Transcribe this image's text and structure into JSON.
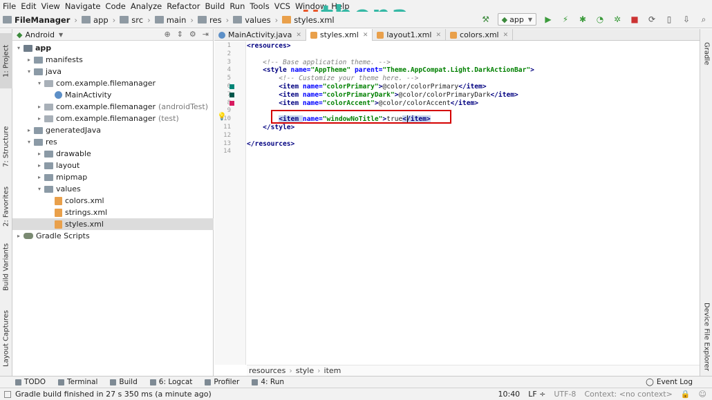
{
  "menu": [
    "File",
    "Edit",
    "View",
    "Navigate",
    "Code",
    "Analyze",
    "Refactor",
    "Build",
    "Run",
    "Tools",
    "VCS",
    "Window",
    "Help"
  ],
  "watermark": {
    "text_u": "u",
    "text_rest": "thena",
    "color_u": "#e8572a",
    "color_rest": "#35b8a5"
  },
  "breadcrumbs": [
    "FileManager",
    "app",
    "src",
    "main",
    "res",
    "values",
    "styles.xml"
  ],
  "run_config": "app",
  "left_tools": [
    "1: Project",
    "7: Structure",
    "2: Favorites",
    "Build Variants",
    "Layout Captures"
  ],
  "right_tools": [
    "Gradle",
    "Device File Explorer"
  ],
  "project": {
    "view": "Android",
    "tree": [
      {
        "label": "app",
        "depth": 0,
        "arrow": "▾",
        "icon": "mod",
        "bold": true
      },
      {
        "label": "manifests",
        "depth": 1,
        "arrow": "▸",
        "icon": "dir"
      },
      {
        "label": "java",
        "depth": 1,
        "arrow": "▾",
        "icon": "dir"
      },
      {
        "label": "com.example.filemanager",
        "depth": 2,
        "arrow": "▾",
        "icon": "pkg"
      },
      {
        "label": "MainActivity",
        "depth": 3,
        "arrow": "",
        "icon": "cls"
      },
      {
        "label": "com.example.filemanager",
        "depth": 2,
        "arrow": "▸",
        "icon": "pkg",
        "suffix": "(androidTest)"
      },
      {
        "label": "com.example.filemanager",
        "depth": 2,
        "arrow": "▸",
        "icon": "pkg",
        "suffix": "(test)"
      },
      {
        "label": "generatedJava",
        "depth": 1,
        "arrow": "▸",
        "icon": "dir"
      },
      {
        "label": "res",
        "depth": 1,
        "arrow": "▾",
        "icon": "dir"
      },
      {
        "label": "drawable",
        "depth": 2,
        "arrow": "▸",
        "icon": "dir"
      },
      {
        "label": "layout",
        "depth": 2,
        "arrow": "▸",
        "icon": "dir"
      },
      {
        "label": "mipmap",
        "depth": 2,
        "arrow": "▸",
        "icon": "dir"
      },
      {
        "label": "values",
        "depth": 2,
        "arrow": "▾",
        "icon": "dir"
      },
      {
        "label": "colors.xml",
        "depth": 3,
        "arrow": "",
        "icon": "xml"
      },
      {
        "label": "strings.xml",
        "depth": 3,
        "arrow": "",
        "icon": "xml"
      },
      {
        "label": "styles.xml",
        "depth": 3,
        "arrow": "",
        "icon": "xml",
        "selected": true
      },
      {
        "label": "Gradle Scripts",
        "depth": 0,
        "arrow": "▸",
        "icon": "grd"
      }
    ]
  },
  "tabs": [
    {
      "label": "MainActivity.java",
      "type": "java"
    },
    {
      "label": "styles.xml",
      "type": "xml",
      "active": true
    },
    {
      "label": "layout1.xml",
      "type": "xml"
    },
    {
      "label": "colors.xml",
      "type": "xml"
    }
  ],
  "line_numbers": [
    "1",
    "2",
    "3",
    "4",
    "5",
    "6",
    "7",
    "8",
    "9",
    "10",
    "11",
    "12",
    "13",
    "14"
  ],
  "gutter_marks": [
    {
      "line": 6,
      "color": "#008577"
    },
    {
      "line": 7,
      "color": "#00574B"
    },
    {
      "line": 8,
      "color": "#D81B60"
    }
  ],
  "code": [
    [
      {
        "t": "<",
        "c": "tg"
      },
      {
        "t": "resources",
        "c": "tg"
      },
      {
        "t": ">",
        "c": "tg"
      }
    ],
    [],
    [
      {
        "t": "    "
      },
      {
        "t": "<!-- Base application theme. -->",
        "c": "cm"
      }
    ],
    [
      {
        "t": "    "
      },
      {
        "t": "<style ",
        "c": "tg"
      },
      {
        "t": "name=",
        "c": "at"
      },
      {
        "t": "\"AppTheme\"",
        "c": "av"
      },
      {
        "t": " "
      },
      {
        "t": "parent=",
        "c": "at"
      },
      {
        "t": "\"Theme.AppCompat.Light.DarkActionBar\"",
        "c": "av"
      },
      {
        "t": ">",
        "c": "tg"
      }
    ],
    [
      {
        "t": "        "
      },
      {
        "t": "<!-- Customize your theme here. -->",
        "c": "cm"
      }
    ],
    [
      {
        "t": "        "
      },
      {
        "t": "<item ",
        "c": "tg"
      },
      {
        "t": "name=",
        "c": "at"
      },
      {
        "t": "\"colorPrimary\"",
        "c": "av"
      },
      {
        "t": ">",
        "c": "tg"
      },
      {
        "t": "@color/colorPrimary"
      },
      {
        "t": "</item>",
        "c": "tg"
      }
    ],
    [
      {
        "t": "        "
      },
      {
        "t": "<item ",
        "c": "tg"
      },
      {
        "t": "name=",
        "c": "at"
      },
      {
        "t": "\"colorPrimaryDark\"",
        "c": "av"
      },
      {
        "t": ">",
        "c": "tg"
      },
      {
        "t": "@color/colorPrimaryDark"
      },
      {
        "t": "</item>",
        "c": "tg"
      }
    ],
    [
      {
        "t": "        "
      },
      {
        "t": "<item ",
        "c": "tg"
      },
      {
        "t": "name=",
        "c": "at"
      },
      {
        "t": "\"colorAccent\"",
        "c": "av"
      },
      {
        "t": ">",
        "c": "tg"
      },
      {
        "t": "@color/colorAccent"
      },
      {
        "t": "</item>",
        "c": "tg"
      }
    ],
    [],
    [
      {
        "t": "        "
      },
      {
        "t": "<item ",
        "c": "tg hl"
      },
      {
        "t": "name=",
        "c": "at"
      },
      {
        "t": "\"windowNoTitle\"",
        "c": "av"
      },
      {
        "t": ">",
        "c": "tg"
      },
      {
        "t": "true"
      },
      {
        "t": "</item>",
        "c": "tg hl"
      }
    ],
    [
      {
        "t": "    "
      },
      {
        "t": "</style>",
        "c": "tg"
      }
    ],
    [],
    [
      {
        "t": "</resources>",
        "c": "tg"
      }
    ],
    []
  ],
  "editor_breadcrumb": [
    "resources",
    "style",
    "item"
  ],
  "bottom_tools": [
    {
      "label": "TODO"
    },
    {
      "label": "Terminal"
    },
    {
      "label": "Build"
    },
    {
      "label": "6: Logcat"
    },
    {
      "label": "Profiler"
    },
    {
      "label": "4: Run"
    }
  ],
  "event_log": "Event Log",
  "status": {
    "message": "Gradle build finished in 27 s 350 ms (a minute ago)",
    "position": "10:40",
    "line_sep": "LF ÷",
    "encoding": "UTF-8",
    "context": "Context: <no context>"
  }
}
